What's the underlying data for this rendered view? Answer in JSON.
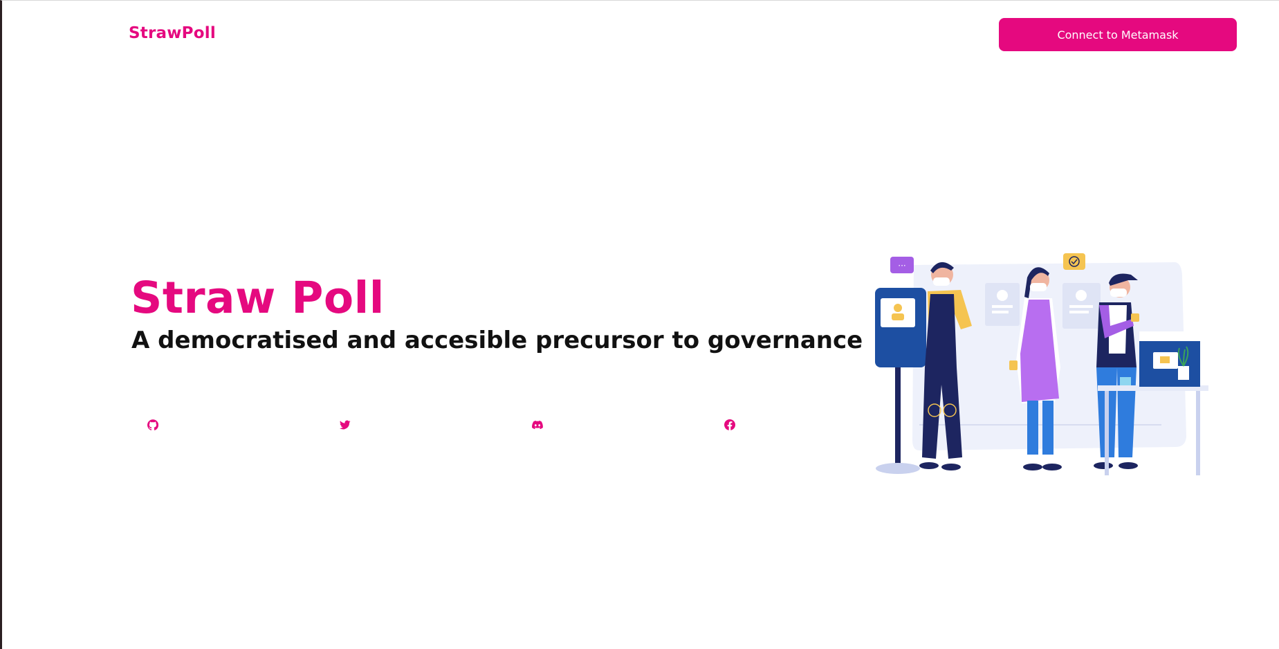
{
  "navbar": {
    "brand": "StrawPoll",
    "connect_label": "Connect to Metamask"
  },
  "hero": {
    "title": "Straw Poll",
    "subtitle": "A democratised and accesible precursor to governance"
  },
  "social": [
    {
      "name": "github-icon"
    },
    {
      "name": "twitter-icon"
    },
    {
      "name": "discord-icon"
    },
    {
      "name": "facebook-icon"
    }
  ],
  "illustration": {
    "name": "voting-people-illustration"
  },
  "colors": {
    "accent": "#e5097f",
    "text": "#111111",
    "background": "#ffffff"
  }
}
